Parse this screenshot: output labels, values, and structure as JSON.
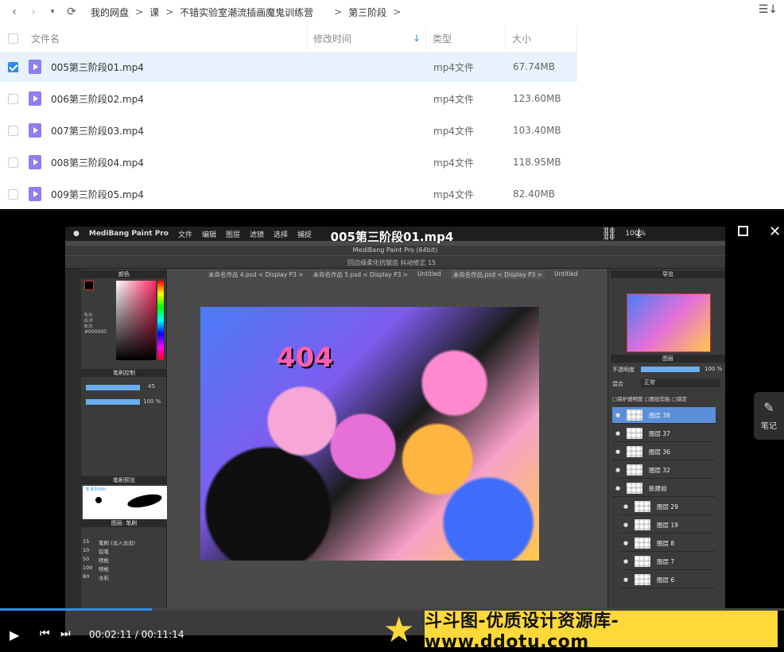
{
  "nav": {
    "back": "‹",
    "forward": "›",
    "breadcrumbs": [
      "我的网盘",
      "课",
      "不错实验室潮流插画魔鬼训练营",
      "第三阶段"
    ],
    "separator": ">"
  },
  "table": {
    "headers": {
      "name": "文件名",
      "modified": "修改时间",
      "sort_arrow": "↓",
      "type": "类型",
      "size": "大小"
    },
    "rows": [
      {
        "name": "005第三阶段01.mp4",
        "type": "mp4文件",
        "size": "67.74MB",
        "selected": true
      },
      {
        "name": "006第三阶段02.mp4",
        "type": "mp4文件",
        "size": "123.60MB",
        "selected": false
      },
      {
        "name": "007第三阶段03.mp4",
        "type": "mp4文件",
        "size": "103.40MB",
        "selected": false
      },
      {
        "name": "008第三阶段04.mp4",
        "type": "mp4文件",
        "size": "118.95MB",
        "selected": false
      },
      {
        "name": "009第三阶段05.mp4",
        "type": "mp4文件",
        "size": "82.40MB",
        "selected": false
      }
    ]
  },
  "player": {
    "title": "005第三阶段01.mp4",
    "current_time": "00:02:11",
    "duration": "00:11:14",
    "time_display": "00:02:11 / 00:11:14",
    "progress": 0.194,
    "notes_label": "笔记",
    "watermark": "斗斗图-优质设计资源库-www.ddotu.com"
  },
  "video_frame": {
    "menubar": [
      "MediBang Paint Pro",
      "文件",
      "编辑",
      "图层",
      "滤镜",
      "选择",
      "捕捉"
    ],
    "menubar_right": "100%",
    "window_title": "MediBang Paint Pro (64bit)",
    "toolbar_text": "回边缘柔化抗锯齿    抖动修正  15",
    "tabs": [
      "未命名作品 4.psd < Display P3 >",
      "未命名作品 5.psd < Display P3 >",
      "Untitled",
      "未命名作品.psd < Display P3 >",
      "Untitled"
    ],
    "color_panel": "颜色",
    "rgb": [
      "R:0",
      "G:0",
      "B:0"
    ],
    "hex": "#000000",
    "brush_control": "笔刷控制",
    "brush_size": "45",
    "brush_opacity": "100 %",
    "brush_preview": "笔刷预览",
    "brush_preview_size": "8.83mm",
    "brush_list_header": "图层: 笔刷",
    "brushes": [
      {
        "size": "15",
        "name": "笔刷 (淡入淡出)"
      },
      {
        "size": "10",
        "name": "铅笔"
      },
      {
        "size": "50",
        "name": "喷枪"
      },
      {
        "size": "100",
        "name": "喷枪"
      },
      {
        "size": "80",
        "name": "水彩"
      }
    ],
    "navigator": "导览",
    "layers_panel": "图层",
    "opacity_label": "不透明度",
    "opacity_value": "100 %",
    "blend_label": "混合",
    "blend_value": "正常",
    "layer_options": "□保护透明度 □图层剪贴 □锁定",
    "layers": [
      {
        "name": "图层 38",
        "active": true
      },
      {
        "name": "图层 37",
        "active": false
      },
      {
        "name": "图层 36",
        "active": false
      },
      {
        "name": "图层 32",
        "active": false
      },
      {
        "name": "新建组",
        "active": false
      },
      {
        "name": "图层 29",
        "active": false
      },
      {
        "name": "图层 19",
        "active": false
      },
      {
        "name": "图层 8",
        "active": false
      },
      {
        "name": "图层 7",
        "active": false
      },
      {
        "name": "图层 6",
        "active": false
      }
    ],
    "artwork_text": "404"
  },
  "colors": {
    "accent": "#2f8ce8",
    "selected_row": "#e8f2fd",
    "file_icon": "#8d7ff0",
    "watermark_bg": "#ffd83a"
  }
}
